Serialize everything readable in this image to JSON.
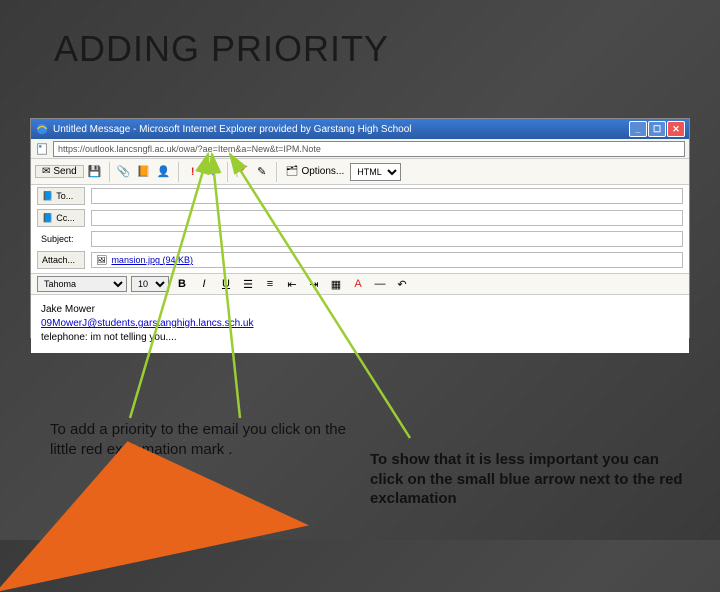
{
  "slide": {
    "title": "ADDING PRIORITY",
    "caption_left": "To add a priority to the email you click on the little red exclamation mark .",
    "caption_right": "To show that it is less important you can click on the small blue arrow next to the red exclamation"
  },
  "browser": {
    "title": "Untitled Message - Microsoft Internet Explorer provided by Garstang High School",
    "url": "https://outlook.lancsngfl.ac.uk/owa/?ae=Item&a=New&t=IPM.Note"
  },
  "toolbar": {
    "send": "Send",
    "options": "Options...",
    "format_value": "HTML"
  },
  "compose": {
    "to_label": "To...",
    "cc_label": "Cc...",
    "subject_label": "Subject:",
    "attach_label": "Attach...",
    "attachment": "mansion.jpg (94 KB)"
  },
  "format_bar": {
    "font": "Tahoma",
    "size": "10",
    "bold": "B",
    "italic": "I",
    "underline": "U"
  },
  "body": {
    "sig_name": "Jake Mower",
    "sig_email": "09MowerJ@students.garstanghigh.lancs.sch.uk",
    "sig_phone": "telephone: im not telling you...."
  }
}
